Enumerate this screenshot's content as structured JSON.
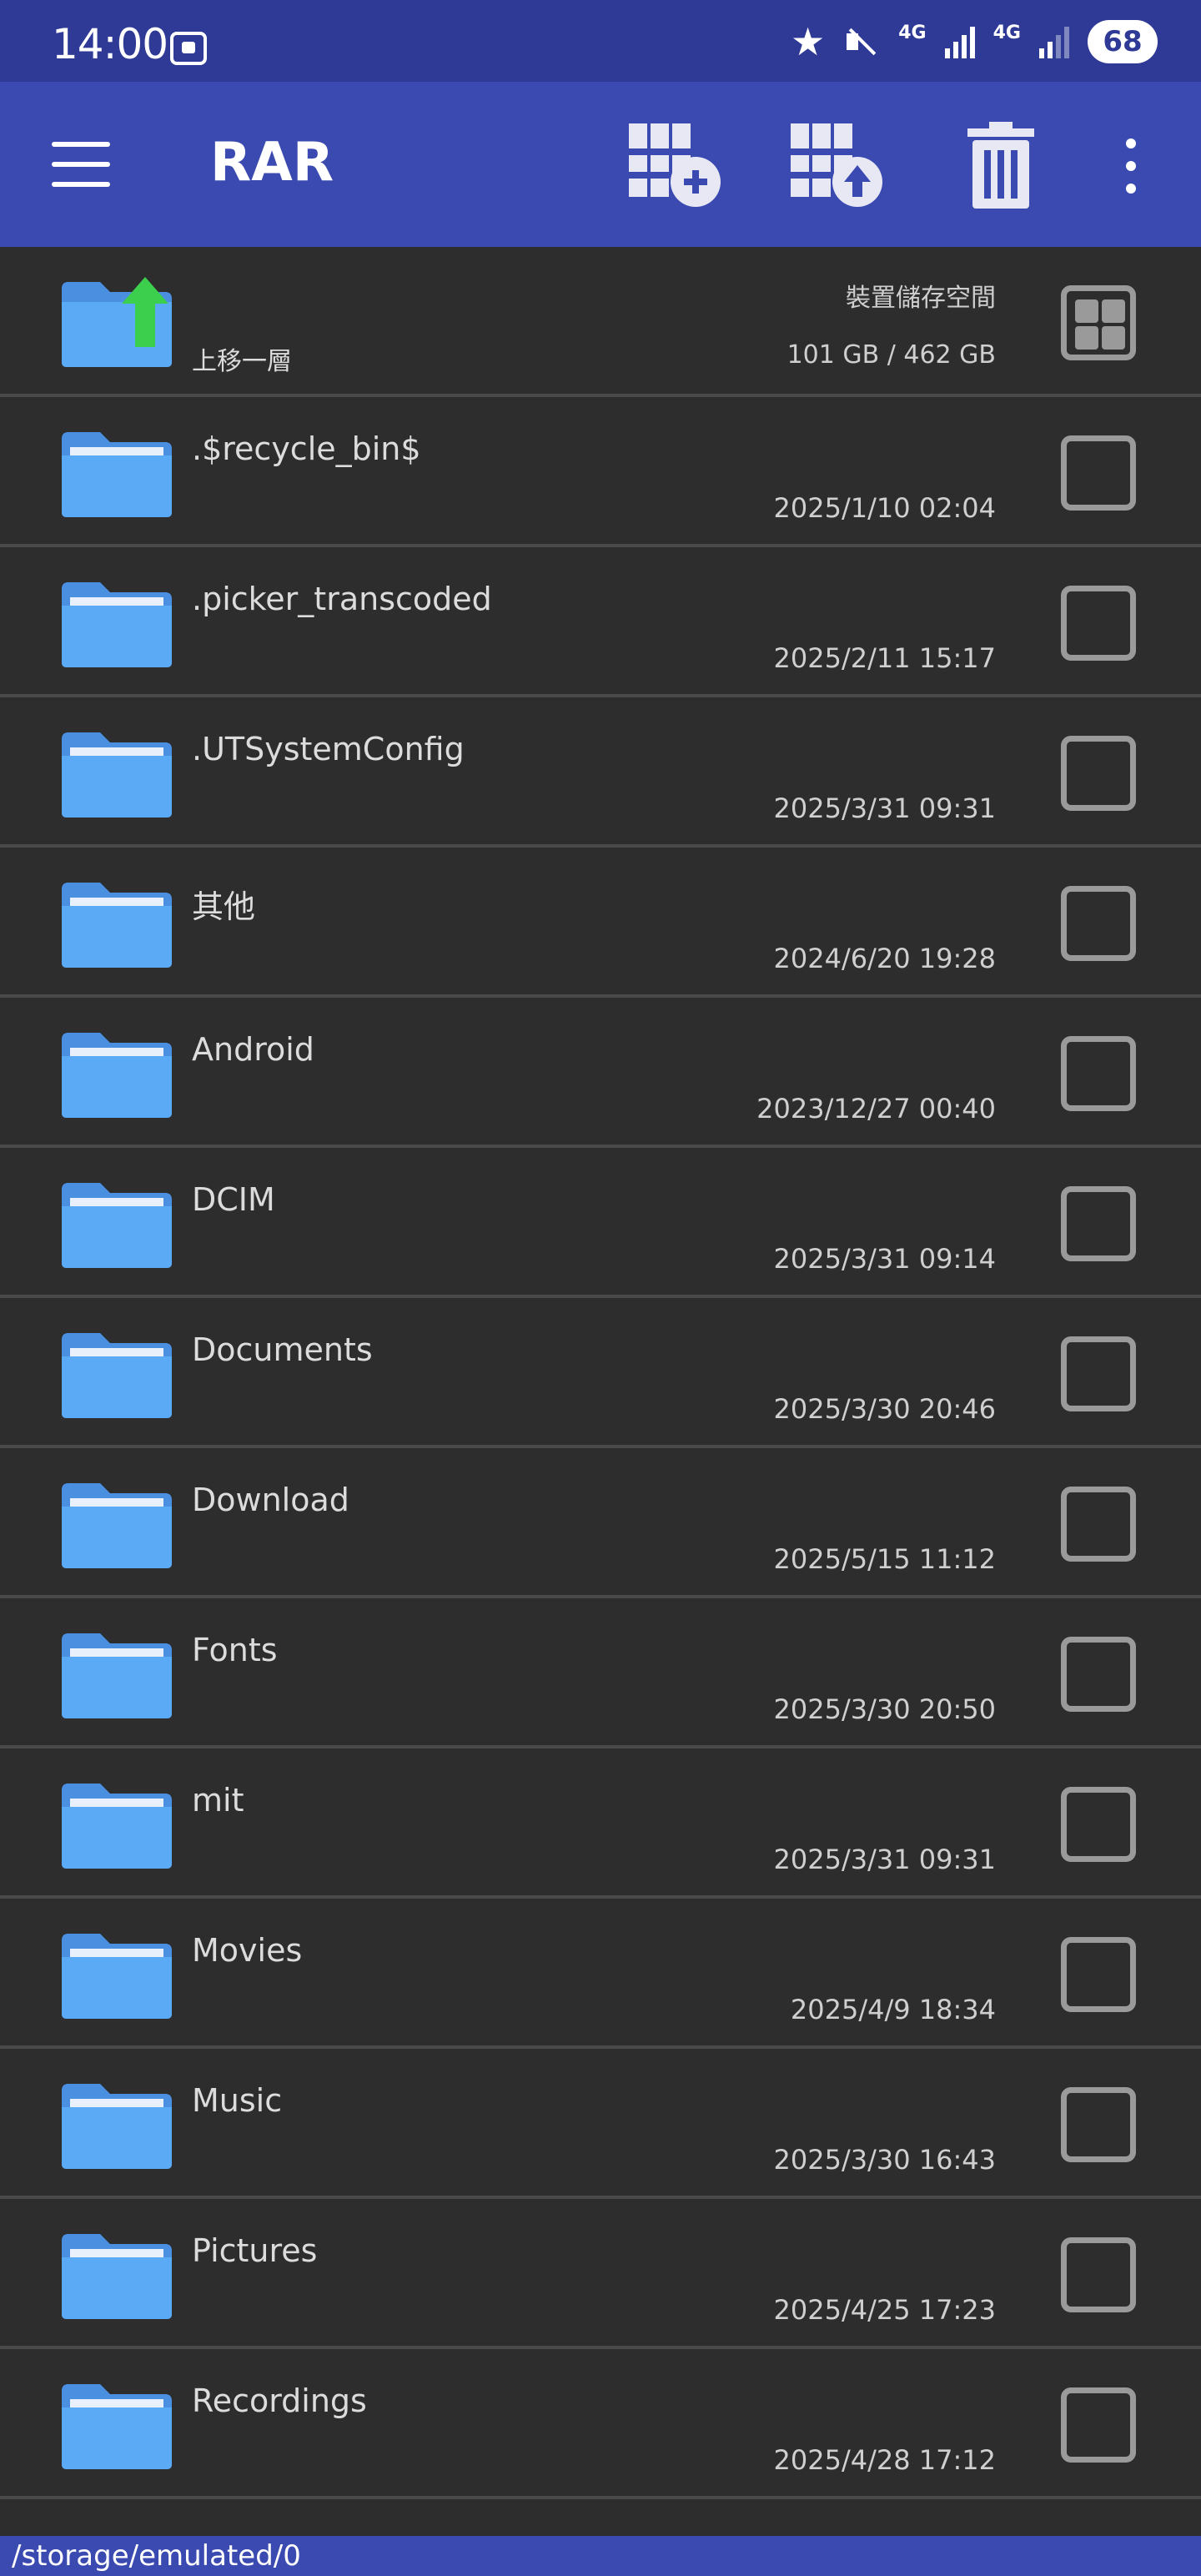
{
  "status_bar": {
    "time": "14:00",
    "network_1": "4G",
    "network_2": "4G",
    "battery": "68"
  },
  "toolbar": {
    "title": "RAR"
  },
  "up_row": {
    "label": "上移一層",
    "storage_label": "裝置儲存空間",
    "storage_value": "101 GB / 462 GB"
  },
  "folders": [
    {
      "name": ".$recycle_bin$",
      "date": "2025/1/10 02:04"
    },
    {
      "name": ".picker_transcoded",
      "date": "2025/2/11 15:17"
    },
    {
      "name": ".UTSystemConfig",
      "date": "2025/3/31 09:31"
    },
    {
      "name": "其他",
      "date": "2024/6/20 19:28"
    },
    {
      "name": "Android",
      "date": "2023/12/27 00:40"
    },
    {
      "name": "DCIM",
      "date": "2025/3/31 09:14"
    },
    {
      "name": "Documents",
      "date": "2025/3/30 20:46"
    },
    {
      "name": "Download",
      "date": "2025/5/15 11:12"
    },
    {
      "name": "Fonts",
      "date": "2025/3/30 20:50"
    },
    {
      "name": "mit",
      "date": "2025/3/31 09:31"
    },
    {
      "name": "Movies",
      "date": "2025/4/9 18:34"
    },
    {
      "name": "Music",
      "date": "2025/3/30 16:43"
    },
    {
      "name": "Pictures",
      "date": "2025/4/25 17:23"
    },
    {
      "name": "Recordings",
      "date": "2025/4/28 17:12"
    }
  ],
  "path_bar": {
    "path": "/storage/emulated/0"
  },
  "colors": {
    "status_bar": "#2f3a96",
    "toolbar": "#3a4ab0",
    "background": "#2d2d2d",
    "folder": "#5aaaf5",
    "up_arrow": "#3ccf4e"
  }
}
